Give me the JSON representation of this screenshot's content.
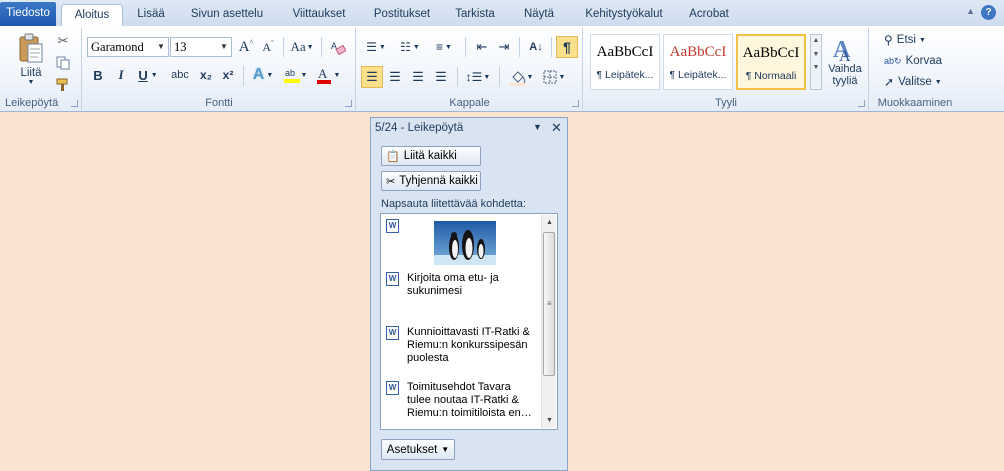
{
  "tabs": [
    "Tiedosto",
    "Aloitus",
    "Lisää",
    "Sivun asettelu",
    "Viittaukset",
    "Postitukset",
    "Tarkista",
    "Näytä",
    "Kehitystyökalut",
    "Acrobat"
  ],
  "help_label": "?",
  "clipboard": {
    "paste_label": "Liitä",
    "group_label": "Leikepöytä"
  },
  "font": {
    "name": "Garamond",
    "size": "13",
    "group_label": "Fontti",
    "bold": "B",
    "italic": "I",
    "underline": "U",
    "strike": "abc",
    "subscript": "x₂",
    "superscript": "x²",
    "case": "Aa"
  },
  "paragraph": {
    "group_label": "Kappale"
  },
  "styles": {
    "group_label": "Tyyli",
    "items": [
      {
        "sample": "AaBbCcI",
        "name": "¶ Leipätek..."
      },
      {
        "sample": "AaBbCcI",
        "name": "¶ Leipätek..."
      },
      {
        "sample": "AaBbCcI",
        "name": "¶ Normaali"
      }
    ],
    "change_label": "Vaihda tyyliä"
  },
  "editing": {
    "group_label": "Muokkaaminen",
    "find": "Etsi",
    "replace": "Korvaa",
    "select": "Valitse"
  },
  "pane": {
    "title": "5/24 - Leikepöytä",
    "paste_all": "Liitä kaikki",
    "clear_all": "Tyhjennä kaikki",
    "hint": "Napsauta liitettävää kohdetta:",
    "items": [
      "Kirjoita oma etu- ja sukunimesi",
      "Kunnioittavasti IT-Ratki & Riemu:n konkurssipesän puolesta",
      "Toimitusehdot Tavara tulee noutaa IT-Ratki & Riemu:n toimitiloista en…"
    ],
    "options": "Asetukset"
  },
  "colors": {
    "accent": "#1b58ae",
    "background": "#fbe3d2"
  }
}
